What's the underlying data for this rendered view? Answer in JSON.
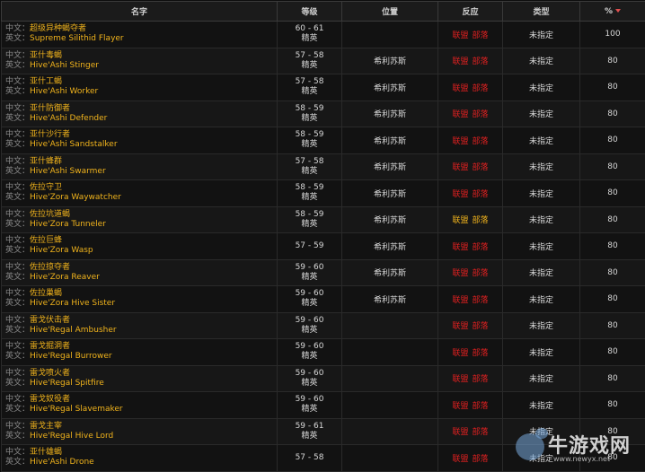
{
  "header": {
    "name": "名字",
    "level": "等级",
    "location": "位置",
    "reaction": "反应",
    "type": "类型",
    "percent": "%"
  },
  "labels": {
    "cn": "中文：",
    "en": "英文："
  },
  "reaction": {
    "alliance": "联盟",
    "horde": "部落"
  },
  "rows": [
    {
      "cn": "超级异种蝎夺者",
      "en": "Supreme Silithid Flayer",
      "level": "60 - 61",
      "rank": "精英",
      "location": "",
      "reaction_color": "red",
      "type": "未指定",
      "percent": "100"
    },
    {
      "cn": "亚什毒蝎",
      "en": "Hive'Ashi Stinger",
      "level": "57 - 58",
      "rank": "精英",
      "location": "希利苏斯",
      "reaction_color": "red",
      "type": "未指定",
      "percent": "80"
    },
    {
      "cn": "亚什工蝎",
      "en": "Hive'Ashi Worker",
      "level": "57 - 58",
      "rank": "精英",
      "location": "希利苏斯",
      "reaction_color": "red",
      "type": "未指定",
      "percent": "80"
    },
    {
      "cn": "亚什防御者",
      "en": "Hive'Ashi Defender",
      "level": "58 - 59",
      "rank": "精英",
      "location": "希利苏斯",
      "reaction_color": "red",
      "type": "未指定",
      "percent": "80"
    },
    {
      "cn": "亚什沙行者",
      "en": "Hive'Ashi Sandstalker",
      "level": "58 - 59",
      "rank": "精英",
      "location": "希利苏斯",
      "reaction_color": "red",
      "type": "未指定",
      "percent": "80"
    },
    {
      "cn": "亚什蜂群",
      "en": "Hive'Ashi Swarmer",
      "level": "57 - 58",
      "rank": "精英",
      "location": "希利苏斯",
      "reaction_color": "red",
      "type": "未指定",
      "percent": "80"
    },
    {
      "cn": "佐拉守卫",
      "en": "Hive'Zora Waywatcher",
      "level": "58 - 59",
      "rank": "精英",
      "location": "希利苏斯",
      "reaction_color": "red",
      "type": "未指定",
      "percent": "80"
    },
    {
      "cn": "佐拉坑道蝎",
      "en": "Hive'Zora Tunneler",
      "level": "58 - 59",
      "rank": "精英",
      "location": "希利苏斯",
      "reaction_color": "yellow",
      "type": "未指定",
      "percent": "80"
    },
    {
      "cn": "佐拉巨蜂",
      "en": "Hive'Zora Wasp",
      "level": "57 - 59",
      "rank": "",
      "location": "希利苏斯",
      "reaction_color": "red",
      "type": "未指定",
      "percent": "80"
    },
    {
      "cn": "佐拉掠夺者",
      "en": "Hive'Zora Reaver",
      "level": "59 - 60",
      "rank": "精英",
      "location": "希利苏斯",
      "reaction_color": "red",
      "type": "未指定",
      "percent": "80"
    },
    {
      "cn": "佐拉巢蝎",
      "en": "Hive'Zora Hive Sister",
      "level": "59 - 60",
      "rank": "精英",
      "location": "希利苏斯",
      "reaction_color": "red",
      "type": "未指定",
      "percent": "80"
    },
    {
      "cn": "雷戈伏击者",
      "en": "Hive'Regal Ambusher",
      "level": "59 - 60",
      "rank": "精英",
      "location": "",
      "reaction_color": "red",
      "type": "未指定",
      "percent": "80"
    },
    {
      "cn": "雷戈掘洞者",
      "en": "Hive'Regal Burrower",
      "level": "59 - 60",
      "rank": "精英",
      "location": "",
      "reaction_color": "red",
      "type": "未指定",
      "percent": "80"
    },
    {
      "cn": "雷戈喷火者",
      "en": "Hive'Regal Spitfire",
      "level": "59 - 60",
      "rank": "精英",
      "location": "",
      "reaction_color": "red",
      "type": "未指定",
      "percent": "80"
    },
    {
      "cn": "雷戈奴役者",
      "en": "Hive'Regal Slavemaker",
      "level": "59 - 60",
      "rank": "精英",
      "location": "",
      "reaction_color": "red",
      "type": "未指定",
      "percent": "80"
    },
    {
      "cn": "雷戈主宰",
      "en": "Hive'Regal Hive Lord",
      "level": "59 - 61",
      "rank": "精英",
      "location": "",
      "reaction_color": "red",
      "type": "未指定",
      "percent": "80"
    },
    {
      "cn": "亚什雄蝎",
      "en": "Hive'Ashi Drone",
      "level": "57 - 58",
      "rank": "",
      "location": "",
      "reaction_color": "red",
      "type": "未指定",
      "percent": "80"
    }
  ],
  "watermark": {
    "text": "牛游戏网",
    "url": "www.newyx.net"
  },
  "colors": {
    "name_value": "#f0b31c",
    "reaction_red": "#e02020",
    "reaction_yellow": "#f0b31c",
    "header_bg": "#1b1b1b"
  }
}
